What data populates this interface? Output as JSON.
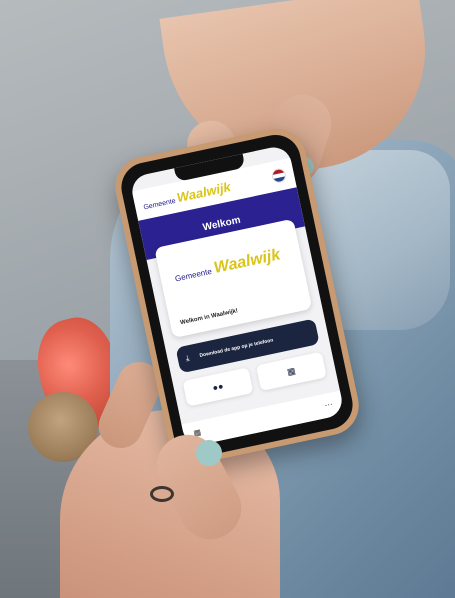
{
  "app": {
    "brand_prefix": "Gemeente",
    "brand_name": "Waalwijk",
    "screen_title": "Welkom",
    "card_welcome": "Welkom in Waalwijk!",
    "download_label": "Download de app op je telefoon",
    "nav_home": "",
    "nav_more": ""
  },
  "icons": {
    "language_flag": "dutch-flag-icon",
    "download": "download-icon",
    "people": "people-icon",
    "calendar": "calendar-icon",
    "home": "home-grid-icon",
    "more": "more-icon"
  },
  "colors": {
    "brand_purple": "#2b2190",
    "brand_yellow": "#d9c51a",
    "button_dark": "#1b2540",
    "phone_case": "#c79a72",
    "nail_polish": "#9fc9c6"
  }
}
